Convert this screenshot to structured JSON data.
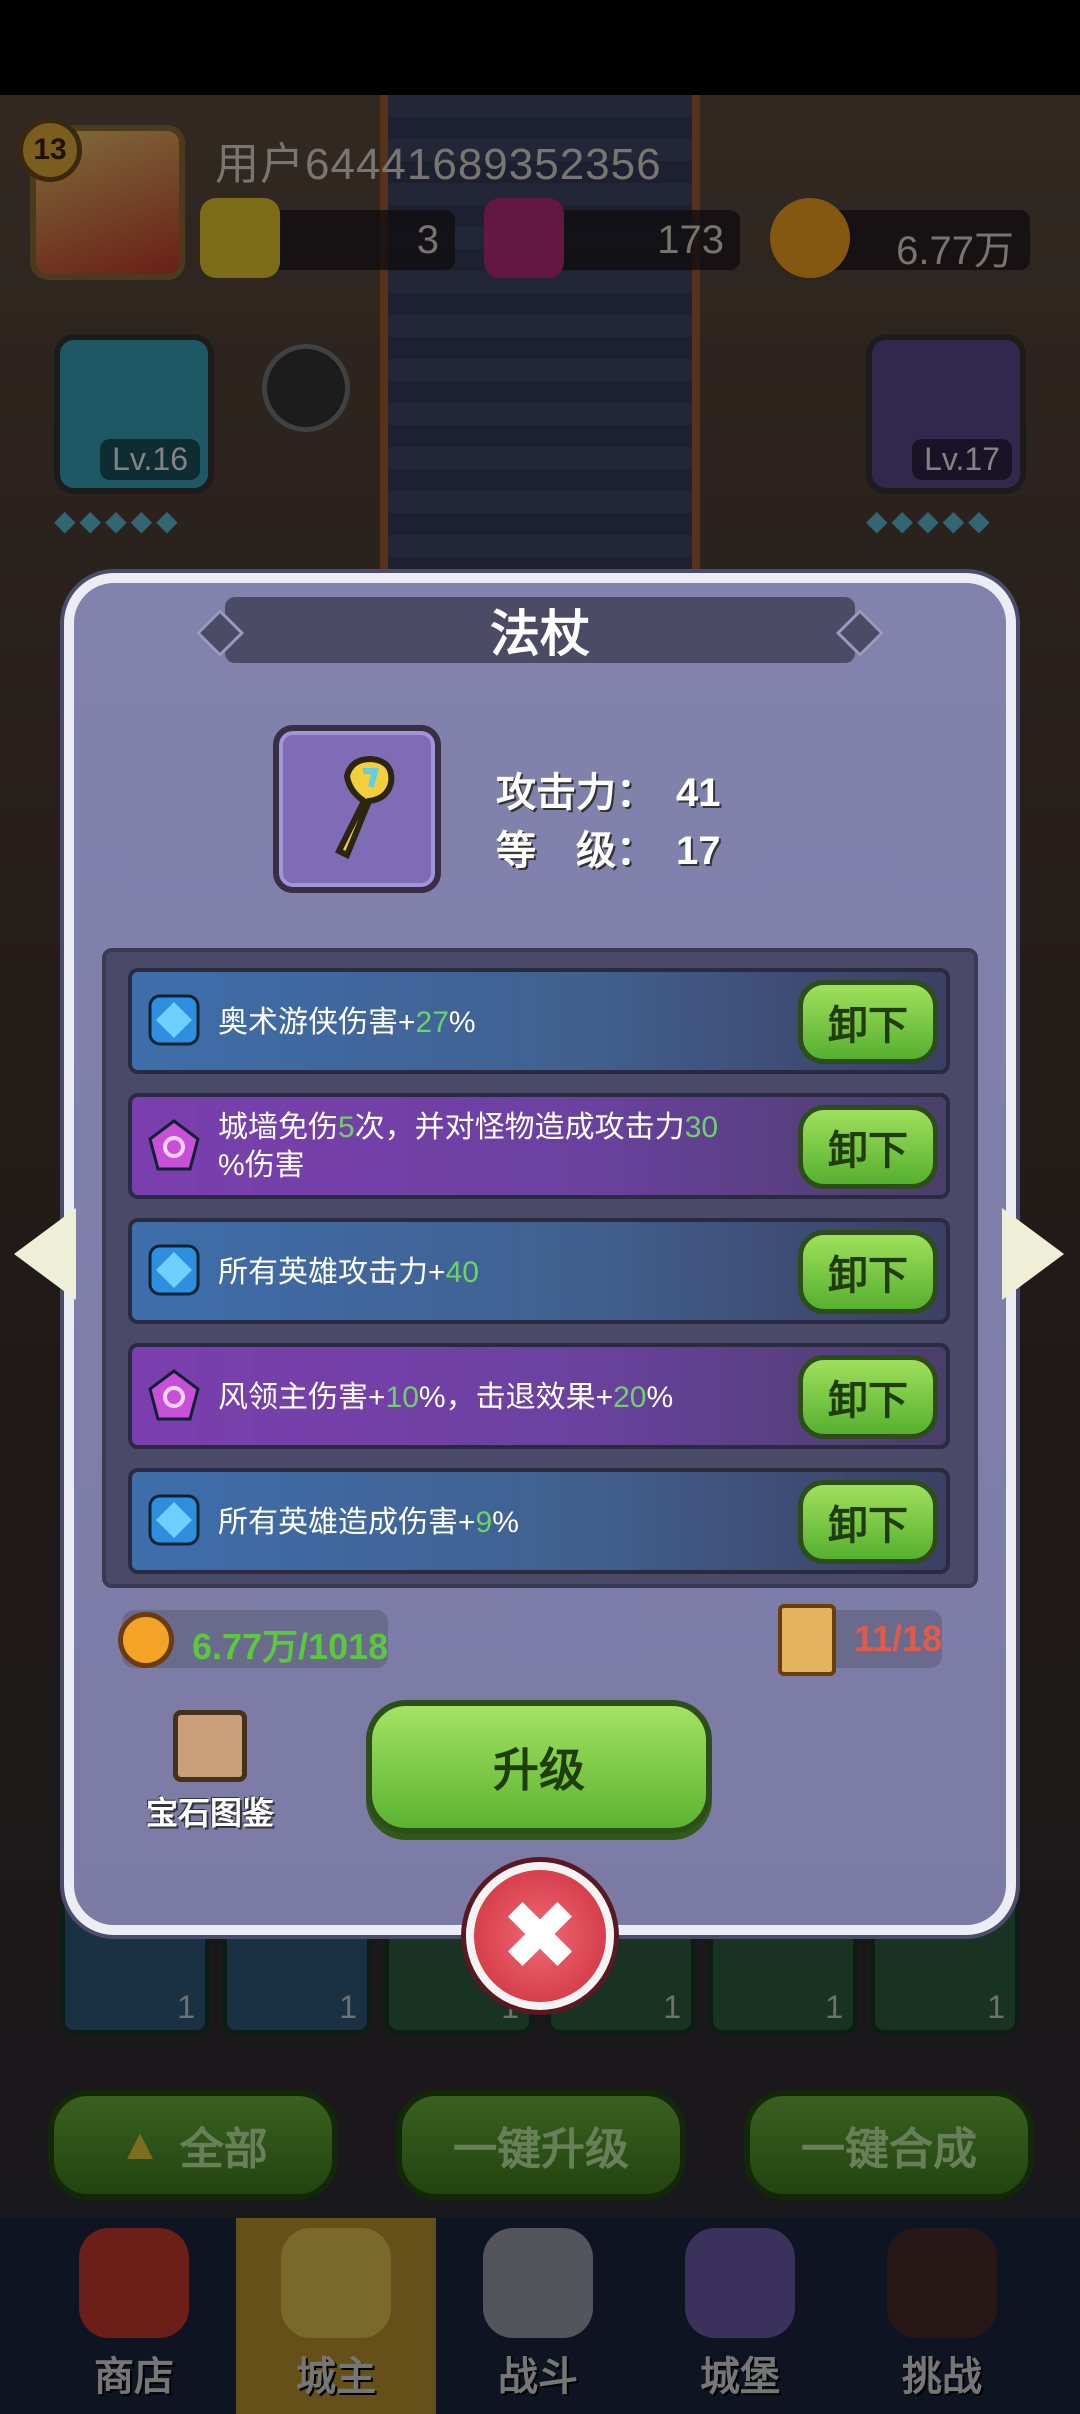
{
  "player": {
    "level": "13",
    "name": "用户64441689352356"
  },
  "resources": [
    {
      "name": "gold-bar",
      "value": "3"
    },
    {
      "name": "gem",
      "value": "173"
    },
    {
      "name": "coin",
      "value": "6.77万"
    }
  ],
  "side_cards": {
    "left_level": "Lv.16",
    "right_level": "Lv.17"
  },
  "dialog": {
    "title": "法杖",
    "stats": [
      {
        "label": "攻击力：",
        "value": "41"
      },
      {
        "label": "等　级：",
        "value": "17"
      }
    ],
    "gems": [
      {
        "color": "blue",
        "parts": [
          "奥术游侠伤害+",
          "27",
          "%"
        ],
        "button": "卸下"
      },
      {
        "color": "purple",
        "parts": [
          "城墙免伤",
          "5",
          "次，并对怪物造成攻击力",
          "30",
          "%伤害"
        ],
        "button": "卸下"
      },
      {
        "color": "blue",
        "parts": [
          "所有英雄攻击力+",
          "40",
          ""
        ],
        "button": "卸下"
      },
      {
        "color": "purple",
        "parts": [
          "风领主伤害+",
          "10",
          "%，击退效果+",
          "20",
          "%"
        ],
        "button": "卸下"
      },
      {
        "color": "blue",
        "parts": [
          "所有英雄造成伤害+",
          "9",
          "%"
        ],
        "button": "卸下"
      }
    ],
    "cost": "6.77万/1018",
    "scrolls": "11/18",
    "codex_label": "宝石图鉴",
    "upgrade_label": "升级",
    "close_symbol": "✖"
  },
  "bottom_buttons": {
    "all": "全部",
    "one_click_upgrade": "一键升级",
    "one_click_merge": "一键合成"
  },
  "inventory_counts": [
    "1",
    "1",
    "1",
    "1",
    "1",
    "1"
  ],
  "nav": {
    "items": [
      {
        "label": "商店",
        "active": false
      },
      {
        "label": "城主",
        "active": true
      },
      {
        "label": "战斗",
        "active": false
      },
      {
        "label": "城堡",
        "active": false
      },
      {
        "label": "挑战",
        "active": false
      }
    ]
  },
  "colors": {
    "dialog_bg": "#7b7ba6",
    "highlight_green": "#6ed26b",
    "button_green": "#8fd94f",
    "close_red": "#e0404e",
    "cost_red": "#e05b4a"
  }
}
